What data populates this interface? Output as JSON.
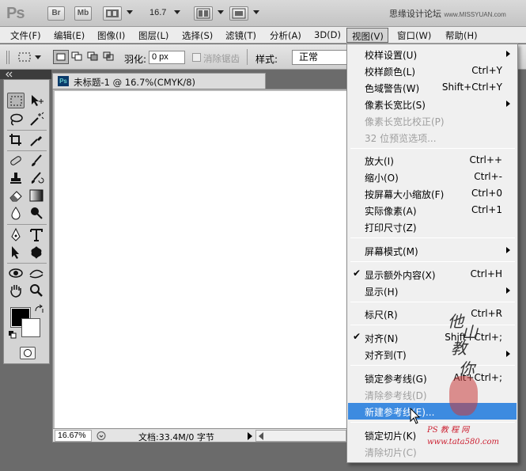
{
  "app": {
    "logo": "Ps",
    "bridge_btn": "Br",
    "minibridge_btn": "Mb",
    "zoom_value": "16.7",
    "watermark": "思缘设计论坛",
    "watermark_site": "www.MISSYUAN.com"
  },
  "menubar": {
    "items": [
      "文件(F)",
      "编辑(E)",
      "图像(I)",
      "图层(L)",
      "选择(S)",
      "滤镜(T)",
      "分析(A)",
      "3D(D)",
      "视图(V)",
      "窗口(W)",
      "帮助(H)"
    ]
  },
  "options": {
    "feather_label": "羽化:",
    "feather_value": "0 px",
    "antialias_label": "消除锯齿",
    "style_label": "样式:",
    "style_value": "正常"
  },
  "document": {
    "tab_icon": "Ps",
    "title": "未标题-1 @ 16.7%(CMYK/8)",
    "zoom": "16.67%",
    "status": "文档:33.4M/0 字节"
  },
  "view_menu": {
    "items": [
      {
        "label": "校样设置(U)",
        "shortcut": "",
        "submenu": true,
        "disabled": false
      },
      {
        "label": "校样颜色(L)",
        "shortcut": "Ctrl+Y",
        "submenu": false,
        "disabled": false
      },
      {
        "label": "色域警告(W)",
        "shortcut": "Shift+Ctrl+Y",
        "submenu": false,
        "disabled": false
      },
      {
        "label": "像素长宽比(S)",
        "shortcut": "",
        "submenu": true,
        "disabled": false
      },
      {
        "label": "像素长宽比校正(P)",
        "shortcut": "",
        "submenu": false,
        "disabled": true
      },
      {
        "label": "32 位预览选项...",
        "shortcut": "",
        "submenu": false,
        "disabled": true
      },
      {
        "label": "放大(I)",
        "shortcut": "Ctrl++",
        "submenu": false,
        "disabled": false
      },
      {
        "label": "缩小(O)",
        "shortcut": "Ctrl+-",
        "submenu": false,
        "disabled": false
      },
      {
        "label": "按屏幕大小缩放(F)",
        "shortcut": "Ctrl+0",
        "submenu": false,
        "disabled": false
      },
      {
        "label": "实际像素(A)",
        "shortcut": "Ctrl+1",
        "submenu": false,
        "disabled": false
      },
      {
        "label": "打印尺寸(Z)",
        "shortcut": "",
        "submenu": false,
        "disabled": false
      },
      {
        "label": "屏幕模式(M)",
        "shortcut": "",
        "submenu": true,
        "disabled": false
      },
      {
        "label": "显示额外内容(X)",
        "shortcut": "Ctrl+H",
        "submenu": false,
        "disabled": false,
        "checked": true
      },
      {
        "label": "显示(H)",
        "shortcut": "",
        "submenu": true,
        "disabled": false
      },
      {
        "label": "标尺(R)",
        "shortcut": "Ctrl+R",
        "submenu": false,
        "disabled": false
      },
      {
        "label": "对齐(N)",
        "shortcut": "Shift+Ctrl+;",
        "submenu": false,
        "disabled": false,
        "checked": true
      },
      {
        "label": "对齐到(T)",
        "shortcut": "",
        "submenu": true,
        "disabled": false
      },
      {
        "label": "锁定参考线(G)",
        "shortcut": "Alt+Ctrl+;",
        "submenu": false,
        "disabled": false
      },
      {
        "label": "清除参考线(D)",
        "shortcut": "",
        "submenu": false,
        "disabled": true
      },
      {
        "label": "新建参考线(E)...",
        "shortcut": "",
        "submenu": false,
        "disabled": false,
        "highlighted": true
      },
      {
        "label": "锁定切片(K)",
        "shortcut": "",
        "submenu": false,
        "disabled": false
      },
      {
        "label": "清除切片(C)",
        "shortcut": "",
        "submenu": false,
        "disabled": true
      }
    ]
  },
  "watermarks": {
    "calligraphy": [
      "他",
      "山",
      "教",
      "你"
    ],
    "bottom_line1": "PS 教 程 网",
    "bottom_line2": "www.tata580.com"
  }
}
